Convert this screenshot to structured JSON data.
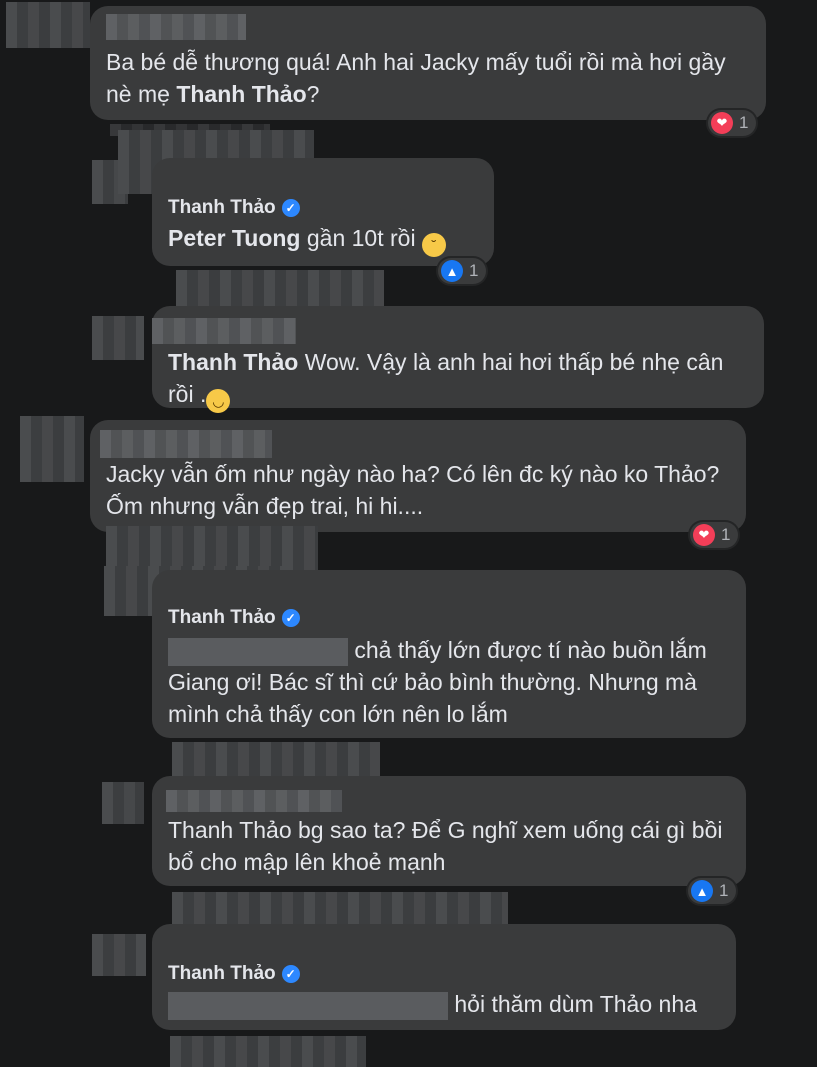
{
  "comments": [
    {
      "text": "Ba bé dễ thương quá! Anh hai Jacky mấy tuổi rồi mà hơi gầy nè mẹ ",
      "mention": "Thanh Thảo",
      "text_end": "?",
      "reaction": {
        "icon": "heart",
        "count": "1"
      }
    },
    {
      "author": "Thanh Thảo",
      "mention": "Peter Tuong",
      "text": " gần 10t rồi ",
      "emoji": "disappointed-face",
      "reaction": {
        "icon": "like",
        "count": "1"
      }
    },
    {
      "mention": "Thanh Thảo",
      "text": " Wow. Vậy là anh hai hơi thấp bé nhẹ cân rồi .",
      "emoji": "grinning-face"
    },
    {
      "text": "Jacky vẫn ốm như ngày nào ha? Có lên đc ký nào ko Thảo? Ốm nhưng vẫn đẹp trai, hi hi....",
      "reaction": {
        "icon": "heart",
        "count": "1"
      }
    },
    {
      "author": "Thanh Thảo",
      "text_line1": "chả thấy lớn được tí nào buồn lắm",
      "text_line2": "Giang ơi! Bác sĩ thì cứ bảo bình thường. Nhưng mà",
      "text_line3": "mình chả thấy con lớn nên lo lắm"
    },
    {
      "text": "Thanh Thảo bg sao ta? Để G nghĩ xem uống cái gì bồi bổ cho mập lên khoẻ mạnh",
      "reaction": {
        "icon": "like",
        "count": "1"
      }
    },
    {
      "author": "Thanh Thảo",
      "text": "hỏi thăm dùm Thảo nha"
    }
  ],
  "icons": {
    "verified": "✓",
    "heart": "❤",
    "like": "👍"
  }
}
